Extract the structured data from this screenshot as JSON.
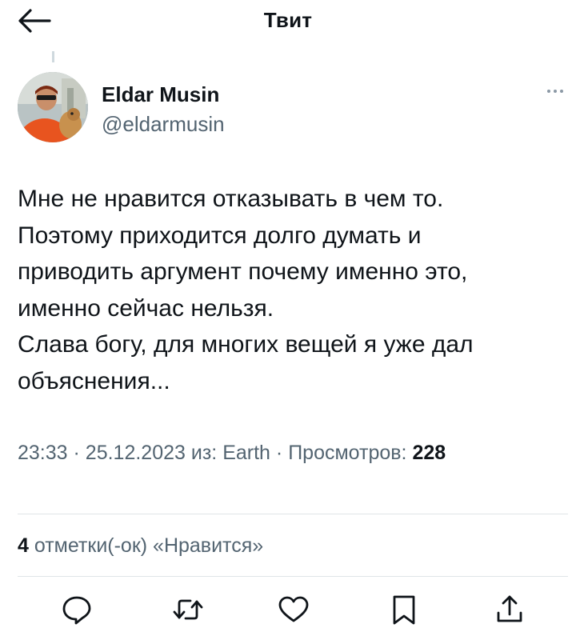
{
  "header": {
    "title": "Твит"
  },
  "author": {
    "name": "Eldar Musin",
    "handle": "@eldarmusin"
  },
  "tweet": {
    "lines": [
      "Мне не нравится отказывать в чем то.",
      "Поэтому приходится долго думать и",
      "приводить аргумент почему именно это,",
      "именно сейчас нельзя.",
      "Слава богу, для многих вещей я уже дал",
      "объяснения..."
    ]
  },
  "meta": {
    "time": "23:33",
    "date": "25.12.2023",
    "source_prefix": "из:",
    "source": "Earth",
    "views_label": "Просмотров:",
    "views_count": "228",
    "separator": "·"
  },
  "likes": {
    "count": "4",
    "label": "отметки(-ок) «Нравится»"
  },
  "actions": [
    {
      "name": "reply",
      "icon": "reply-icon"
    },
    {
      "name": "retweet",
      "icon": "retweet-icon"
    },
    {
      "name": "like",
      "icon": "heart-icon"
    },
    {
      "name": "bookmark",
      "icon": "bookmark-icon"
    },
    {
      "name": "share",
      "icon": "share-icon"
    }
  ],
  "colors": {
    "text": "#0f1419",
    "secondary": "#536471",
    "divider": "#dfe5e8",
    "avatar_shirt": "#e8541f"
  }
}
